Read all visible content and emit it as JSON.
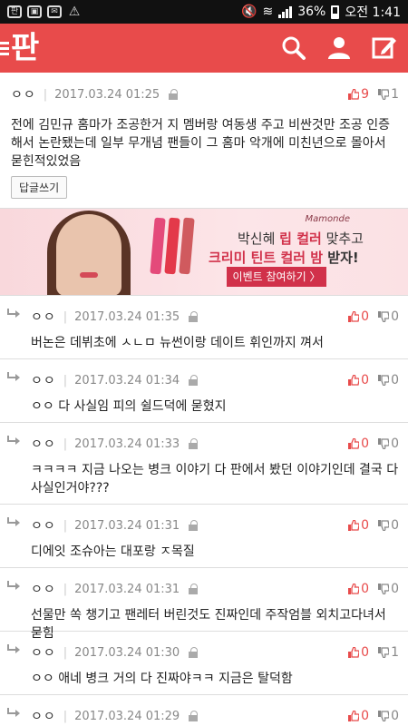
{
  "statusbar": {
    "left_icons": [
      "pann-icon",
      "gallery-icon",
      "chat-icon",
      "warning-icon"
    ],
    "battery": "36%",
    "time": "오전 1:41"
  },
  "appbar": {
    "logo_text": "판",
    "accent": "#e84b4b"
  },
  "top_comment": {
    "author": "ㅇㅇ",
    "date": "2017.03.24 01:25",
    "up": "9",
    "down": "1",
    "text": "전에 김민규 홈마가 조공한거 지 멤버랑 여동생 주고 비싼것만 조공 인증해서 논란됐는데 일부 무개념 팬들이 그 홈마 악개에 미친년으로 몰아서 묻힌적있었음",
    "reply_button": "답글쓰기"
  },
  "ad": {
    "brand": "Mamonde",
    "line1_prefix": "박신혜 ",
    "line1_bold": "립 컬러",
    "line1_suffix": " 맞추고",
    "line2_bold": "크리미 틴트 컬러 밤",
    "line2_suffix": " 받자!",
    "cta": "이벤트 참여하기 〉"
  },
  "replies": [
    {
      "author": "ㅇㅇ",
      "date": "2017.03.24 01:35",
      "up": "0",
      "down": "0",
      "text": "버논은 데뷔초에 ㅅㄴㅁ 뉴썬이랑 데이트 휘인까지 껴서"
    },
    {
      "author": "ㅇㅇ",
      "date": "2017.03.24 01:34",
      "up": "0",
      "down": "0",
      "text": "ㅇㅇ 다 사실임 피의 쉴드덕에 묻혔지"
    },
    {
      "author": "ㅇㅇ",
      "date": "2017.03.24 01:33",
      "up": "0",
      "down": "0",
      "text": "ㅋㅋㅋㅋ 지금 나오는 병크 이야기 다 판에서 봤던 이야기인데 결국 다 사실인거야???"
    },
    {
      "author": "ㅇㅇ",
      "date": "2017.03.24 01:31",
      "up": "0",
      "down": "0",
      "text": "디에잇 조슈아는 대포랑 ㅈ목질"
    },
    {
      "author": "ㅇㅇ",
      "date": "2017.03.24 01:31",
      "up": "0",
      "down": "0",
      "text": "선물만 쏙 챙기고 팬레터 버린것도 진짜인데 주작엄블 외치고다녀서 묻힘"
    },
    {
      "author": "ㅇㅇ",
      "date": "2017.03.24 01:30",
      "up": "0",
      "down": "1",
      "text": "ㅇㅇ 애네 병크 거의 다 진짜야ㅋㅋ 지금은 탈덕함"
    },
    {
      "author": "ㅇㅇ",
      "date": "2017.03.24 01:29",
      "up": "0",
      "down": "0",
      "text": ""
    }
  ]
}
